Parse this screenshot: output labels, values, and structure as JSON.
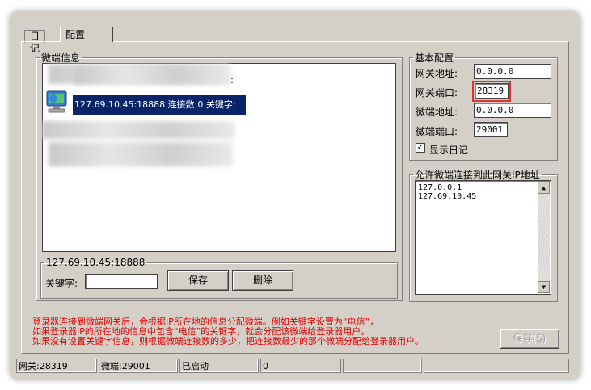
{
  "tabs": [
    {
      "label": "日记"
    },
    {
      "label": "配置"
    }
  ],
  "micro_info": {
    "legend": "微端信息",
    "selected_item": "127.69.10.45:18888 连接数:0 关键字:",
    "edit_group_title": "127.69.10.45:18888",
    "keyword_label": "关键字:",
    "keyword_value": "",
    "save_label": "保存",
    "delete_label": "删除"
  },
  "basic_config": {
    "legend": "基本配置",
    "gateway_addr_label": "网关地址:",
    "gateway_addr_value": "0.0.0.0",
    "gateway_port_label": "网关端口:",
    "gateway_port_value": "28319",
    "micro_addr_label": "微端地址:",
    "micro_addr_value": "0.0.0.0",
    "micro_port_label": "微端端口:",
    "micro_port_value": "29001",
    "show_log_label": "显示日记",
    "show_log_checked": true
  },
  "allowed_ips": {
    "legend": "允许微端连接到此网关IP地址",
    "ips": [
      "127.0.0.1",
      "127.69.10.45"
    ]
  },
  "notes": [
    "登录器连接到微端网关后，会根据IP所在地的信息分配微端。例如关键字设置为“电信”，",
    "如果登录器IP的所在地的信息中包含“电信”的关键字，就会分配该微端给登录器用户。",
    "如果没有设置关键字信息，则根据微端连接数的多少，把连接数最少的那个微端分配给登录器用户。"
  ],
  "save_disabled_label": "保存(S)",
  "status_bar": {
    "gateway": "网关:28319",
    "micro": "微端:29001",
    "state": "已启动",
    "count": "0"
  }
}
